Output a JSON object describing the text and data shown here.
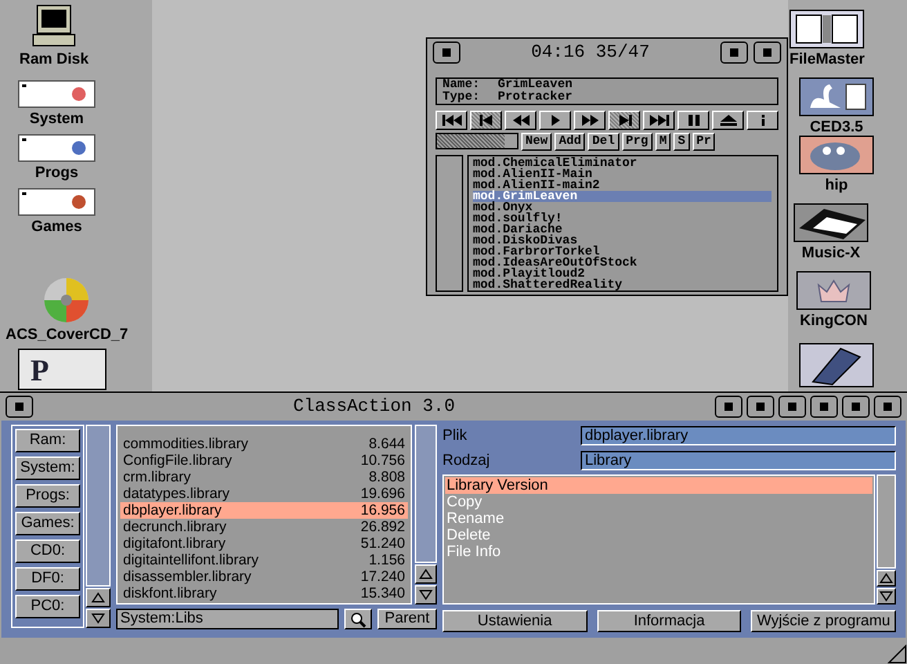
{
  "desktop_left": [
    {
      "kind": "computer",
      "label": "Ram Disk"
    },
    {
      "kind": "drive",
      "label": "System",
      "color": "#e06060"
    },
    {
      "kind": "drive",
      "label": "Progs",
      "color": "#5070c0"
    },
    {
      "kind": "drive",
      "label": "Games",
      "color": "#c05030"
    },
    {
      "kind": "cd",
      "label": "ACS_CoverCD_7"
    },
    {
      "kind": "letter",
      "label": "P"
    }
  ],
  "desktop_right": [
    {
      "kind": "filemaster",
      "label": "FileMaster"
    },
    {
      "kind": "swan",
      "label": "CED3.5"
    },
    {
      "kind": "hippo",
      "label": "hip"
    },
    {
      "kind": "keyboard",
      "label": "Music-X"
    },
    {
      "kind": "crown",
      "label": "KingCON"
    },
    {
      "kind": "asm"
    }
  ],
  "player": {
    "time": "04:16 35/47",
    "name_label": "Name:",
    "name": "GrimLeaven",
    "type_label": "Type:",
    "type": "Protracker",
    "transport": [
      {
        "kind": "first",
        "disabled": false
      },
      {
        "kind": "prev",
        "disabled": true
      },
      {
        "kind": "rewind",
        "disabled": false
      },
      {
        "kind": "play",
        "disabled": false
      },
      {
        "kind": "forward",
        "disabled": false
      },
      {
        "kind": "next",
        "disabled": true
      },
      {
        "kind": "last",
        "disabled": false
      },
      {
        "kind": "pause",
        "disabled": false
      },
      {
        "kind": "eject",
        "disabled": false
      },
      {
        "kind": "info",
        "disabled": false
      }
    ],
    "level": 0.85,
    "buttons": [
      "New",
      "Add",
      "Del",
      "Prg",
      "M",
      "S",
      "Pr"
    ],
    "playlist": [
      {
        "name": "mod.ChemicalEliminator",
        "selected": false
      },
      {
        "name": "mod.AlienII-Main",
        "selected": false
      },
      {
        "name": "mod.AlienII-main2",
        "selected": false
      },
      {
        "name": "mod.GrimLeaven",
        "selected": true
      },
      {
        "name": "mod.Onyx",
        "selected": false
      },
      {
        "name": "mod.soulfly!",
        "selected": false
      },
      {
        "name": "mod.Dariache",
        "selected": false
      },
      {
        "name": "mod.DiskoDivas",
        "selected": false
      },
      {
        "name": "mod.FarbrorTorkel",
        "selected": false
      },
      {
        "name": "mod.IdeasAreOutOfStock",
        "selected": false
      },
      {
        "name": "mod.Playitloud2",
        "selected": false
      },
      {
        "name": "mod.ShatteredReality",
        "selected": false
      }
    ]
  },
  "classaction": {
    "title": "ClassAction 3.0",
    "devices": [
      "Ram:",
      "System:",
      "Progs:",
      "Games:",
      "CD0:",
      "DF0:",
      "PC0:"
    ],
    "files": [
      {
        "name": "commodities.library",
        "size": "8.644",
        "selected": false
      },
      {
        "name": "ConfigFile.library",
        "size": "10.756",
        "selected": false
      },
      {
        "name": "crm.library",
        "size": "8.808",
        "selected": false
      },
      {
        "name": "datatypes.library",
        "size": "19.696",
        "selected": false
      },
      {
        "name": "dbplayer.library",
        "size": "16.956",
        "selected": true
      },
      {
        "name": "decrunch.library",
        "size": "26.892",
        "selected": false
      },
      {
        "name": "digitafont.library",
        "size": "51.240",
        "selected": false
      },
      {
        "name": "digitaintellifont.library",
        "size": "1.156",
        "selected": false
      },
      {
        "name": "disassembler.library",
        "size": "17.240",
        "selected": false
      },
      {
        "name": "diskfont.library",
        "size": "15.340",
        "selected": false
      }
    ],
    "path": "System:Libs",
    "parent_button": "Parent",
    "file_label": "Plik",
    "file_value": "dbplayer.library",
    "type_label": "Rodzaj",
    "type_value": "Library",
    "actions": [
      {
        "label": "Library Version",
        "selected": true
      },
      {
        "label": "Copy",
        "selected": false
      },
      {
        "label": "Rename",
        "selected": false
      },
      {
        "label": "Delete",
        "selected": false
      },
      {
        "label": "File Info",
        "selected": false
      }
    ],
    "buttons": [
      "Ustawienia",
      "Informacja",
      "Wyjście z programu"
    ]
  }
}
